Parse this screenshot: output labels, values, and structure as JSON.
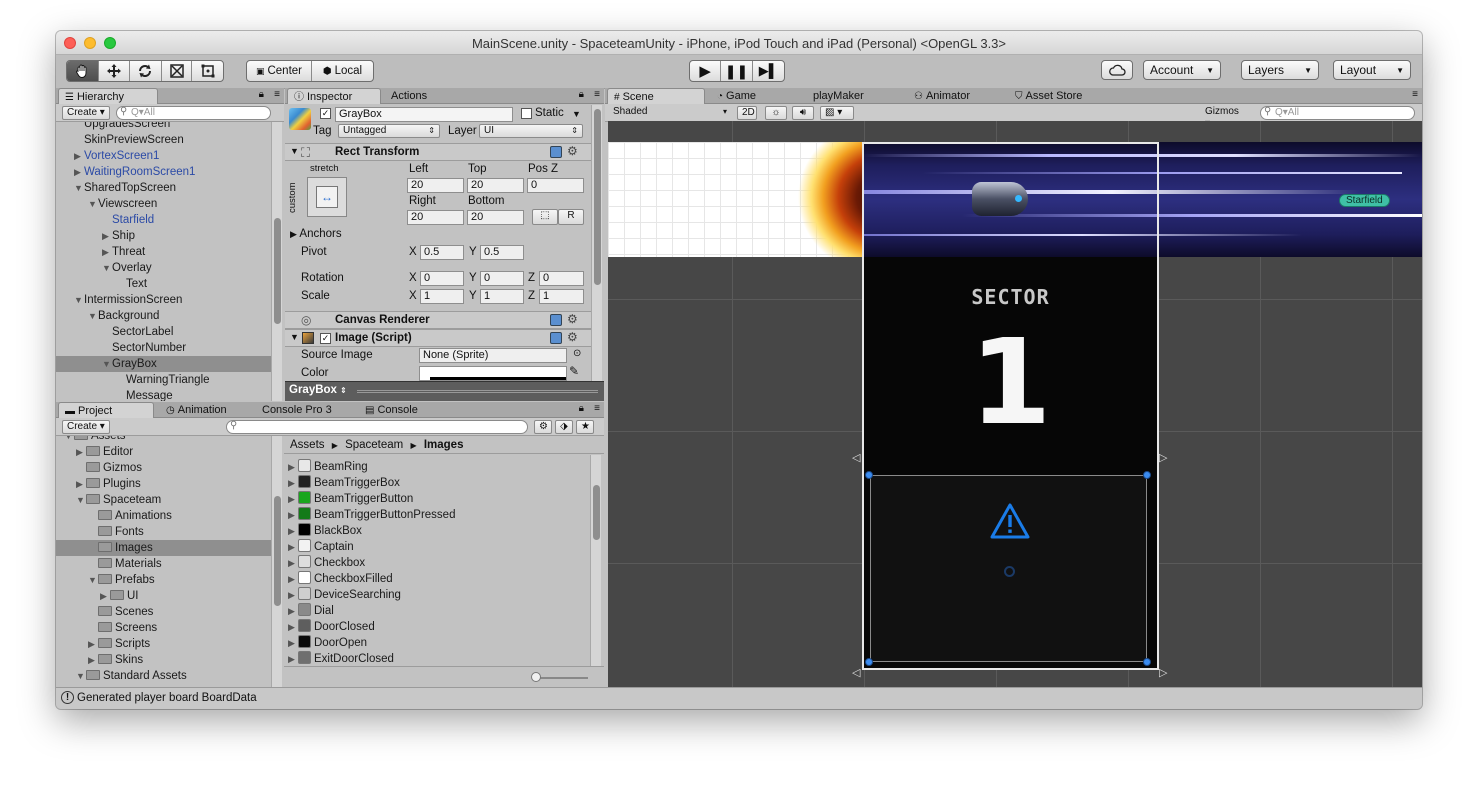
{
  "window": {
    "title": "MainScene.unity - SpaceteamUnity - iPhone, iPod Touch and iPad (Personal) <OpenGL 3.3>"
  },
  "toolbar": {
    "tools": [
      "hand-tool",
      "move-tool",
      "rotate-tool",
      "scale-tool",
      "rect-tool"
    ],
    "pivot_label": "Center",
    "space_label": "Local",
    "account_label": "Account",
    "layers_label": "Layers",
    "layout_label": "Layout"
  },
  "hierarchy": {
    "tab": "Hierarchy",
    "create_label": "Create",
    "search_placeholder": "Q▾All",
    "items": [
      {
        "label": "UpgradesScreen",
        "indent": 2,
        "fold": "",
        "blue": false
      },
      {
        "label": "SkinPreviewScreen",
        "indent": 2,
        "fold": "",
        "blue": false
      },
      {
        "label": "VortexScreen1",
        "indent": 2,
        "fold": "▶",
        "blue": true
      },
      {
        "label": "WaitingRoomScreen1",
        "indent": 2,
        "fold": "▶",
        "blue": true
      },
      {
        "label": "SharedTopScreen",
        "indent": 2,
        "fold": "▼",
        "blue": false
      },
      {
        "label": "Viewscreen",
        "indent": 3,
        "fold": "▼",
        "blue": false
      },
      {
        "label": "Starfield",
        "indent": 4,
        "fold": "",
        "blue": true
      },
      {
        "label": "Ship",
        "indent": 4,
        "fold": "▶",
        "blue": false
      },
      {
        "label": "Threat",
        "indent": 4,
        "fold": "▶",
        "blue": false
      },
      {
        "label": "Overlay",
        "indent": 4,
        "fold": "▼",
        "blue": false
      },
      {
        "label": "Text",
        "indent": 5,
        "fold": "",
        "blue": false
      },
      {
        "label": "IntermissionScreen",
        "indent": 2,
        "fold": "▼",
        "blue": false
      },
      {
        "label": "Background",
        "indent": 3,
        "fold": "▼",
        "blue": false
      },
      {
        "label": "SectorLabel",
        "indent": 4,
        "fold": "",
        "blue": false
      },
      {
        "label": "SectorNumber",
        "indent": 4,
        "fold": "",
        "blue": false
      },
      {
        "label": "GrayBox",
        "indent": 4,
        "fold": "▼",
        "blue": false,
        "selected": true
      },
      {
        "label": "WarningTriangle",
        "indent": 5,
        "fold": "",
        "blue": false
      },
      {
        "label": "Message",
        "indent": 5,
        "fold": "",
        "blue": false
      }
    ]
  },
  "inspector": {
    "tabs": [
      "Inspector",
      "Actions"
    ],
    "object_name": "GrayBox",
    "static_label": "Static",
    "tag_label": "Tag",
    "tag_value": "Untagged",
    "layer_label": "Layer",
    "layer_value": "UI",
    "rect_transform": {
      "title": "Rect Transform",
      "stretch_label": "stretch",
      "custom_label": "custom",
      "left_label": "Left",
      "left_value": "20",
      "top_label": "Top",
      "top_value": "20",
      "posz_label": "Pos Z",
      "posz_value": "0",
      "right_label": "Right",
      "right_value": "20",
      "bottom_label": "Bottom",
      "bottom_value": "20",
      "r_label": "R",
      "anchors_label": "Anchors",
      "pivot_label": "Pivot",
      "pivot_x": "0.5",
      "pivot_y": "0.5",
      "rotation_label": "Rotation",
      "rot_x": "0",
      "rot_y": "0",
      "rot_z": "0",
      "scale_label": "Scale",
      "scale_x": "1",
      "scale_y": "1",
      "scale_z": "1",
      "x_label": "X",
      "y_label": "Y",
      "z_label": "Z"
    },
    "canvas_renderer": "Canvas Renderer",
    "image_script": {
      "title": "Image (Script)",
      "source_label": "Source Image",
      "source_value": "None (Sprite)",
      "color_label": "Color"
    },
    "footer_label": "GrayBox"
  },
  "project": {
    "tabs": [
      "Project",
      "Animation",
      "Console Pro 3",
      "Console"
    ],
    "create_label": "Create",
    "breadcrumb": [
      "Assets",
      "Spaceteam",
      "Images"
    ],
    "folders": [
      {
        "label": "Assets",
        "indent": 0,
        "fold": "▼"
      },
      {
        "label": "Editor",
        "indent": 1,
        "fold": "▶"
      },
      {
        "label": "Gizmos",
        "indent": 1,
        "fold": ""
      },
      {
        "label": "Plugins",
        "indent": 1,
        "fold": "▶"
      },
      {
        "label": "Spaceteam",
        "indent": 1,
        "fold": "▼"
      },
      {
        "label": "Animations",
        "indent": 2,
        "fold": ""
      },
      {
        "label": "Fonts",
        "indent": 2,
        "fold": ""
      },
      {
        "label": "Images",
        "indent": 2,
        "fold": "",
        "selected": true
      },
      {
        "label": "Materials",
        "indent": 2,
        "fold": ""
      },
      {
        "label": "Prefabs",
        "indent": 2,
        "fold": "▼"
      },
      {
        "label": "UI",
        "indent": 3,
        "fold": "▶"
      },
      {
        "label": "Scenes",
        "indent": 2,
        "fold": ""
      },
      {
        "label": "Screens",
        "indent": 2,
        "fold": ""
      },
      {
        "label": "Scripts",
        "indent": 2,
        "fold": "▶"
      },
      {
        "label": "Skins",
        "indent": 2,
        "fold": "▶"
      },
      {
        "label": "Standard Assets",
        "indent": 1,
        "fold": "▼"
      }
    ],
    "assets": [
      {
        "label": "BeamRing",
        "color": "#e8e8e8"
      },
      {
        "label": "BeamTriggerBox",
        "color": "#222222"
      },
      {
        "label": "BeamTriggerButton",
        "color": "#19a61d"
      },
      {
        "label": "BeamTriggerButtonPressed",
        "color": "#147a18"
      },
      {
        "label": "BlackBox",
        "color": "#000000"
      },
      {
        "label": "Captain",
        "color": "#f2f2f2"
      },
      {
        "label": "Checkbox",
        "color": "#dddddd"
      },
      {
        "label": "CheckboxFilled",
        "color": "#ffffff"
      },
      {
        "label": "DeviceSearching",
        "color": "#cfcfcf"
      },
      {
        "label": "Dial",
        "color": "#8a8a8a"
      },
      {
        "label": "DoorClosed",
        "color": "#5e5e5e"
      },
      {
        "label": "DoorOpen",
        "color": "#0a0a0a"
      },
      {
        "label": "ExitDoorClosed",
        "color": "#6f6f6f"
      }
    ]
  },
  "scene": {
    "tabs": [
      "Scene",
      "Game",
      "playMaker",
      "Animator",
      "Asset Store"
    ],
    "shading": "Shaded",
    "mode_2d": "2D",
    "gizmos_label": "Gizmos",
    "search_placeholder": "Q▾All",
    "sector_label": "SECTOR",
    "sector_number": "1",
    "starfield_tag": "Starfield"
  },
  "status": {
    "message": "Generated player board BoardData"
  }
}
